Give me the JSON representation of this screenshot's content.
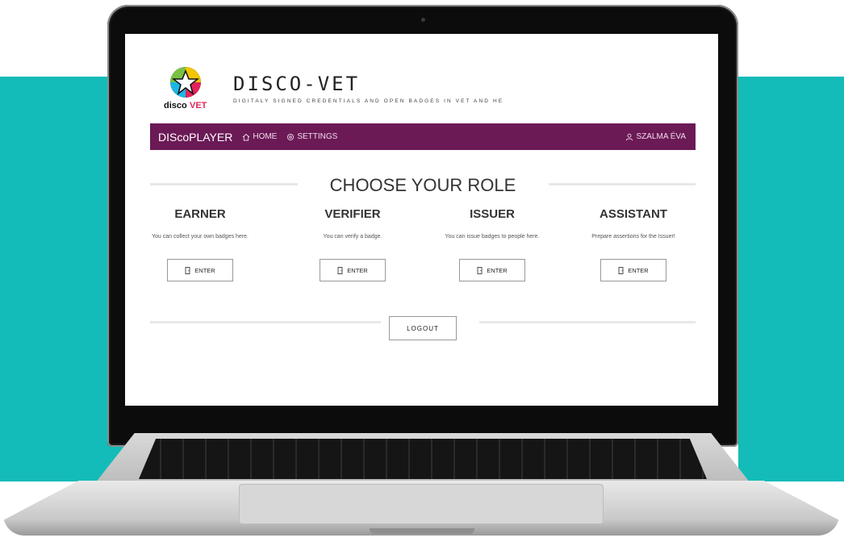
{
  "brand": {
    "title": "DISCO-VET",
    "subtitle": "DIGITALY SIGNED CREDENTIALS AND OPEN BADGES IN VET AND HE",
    "logo_text": "disco",
    "logo_text_accent": "VET"
  },
  "navbar": {
    "brand": "DIScoPLAYER",
    "home": "HOME",
    "settings": "SETTINGS",
    "user": "SZALMA ÉVA"
  },
  "main": {
    "heading": "CHOOSE YOUR ROLE",
    "roles": [
      {
        "title": "EARNER",
        "description": "You can collect your own badges here.",
        "button": "ENTER"
      },
      {
        "title": "VERIFIER",
        "description": "You can verify a badge.",
        "button": "ENTER"
      },
      {
        "title": "ISSUER",
        "description": "You can issue badges to people here.",
        "button": "ENTER"
      },
      {
        "title": "ASSISTANT",
        "description": "Prepare assertions for the Issuer!",
        "button": "ENTER"
      }
    ],
    "logout": "LOGOUT"
  },
  "colors": {
    "navbar": "#6b1a56",
    "background_accent": "#13bcb8"
  },
  "icons": [
    "home-icon",
    "settings-icon",
    "user-icon",
    "door-icon"
  ]
}
